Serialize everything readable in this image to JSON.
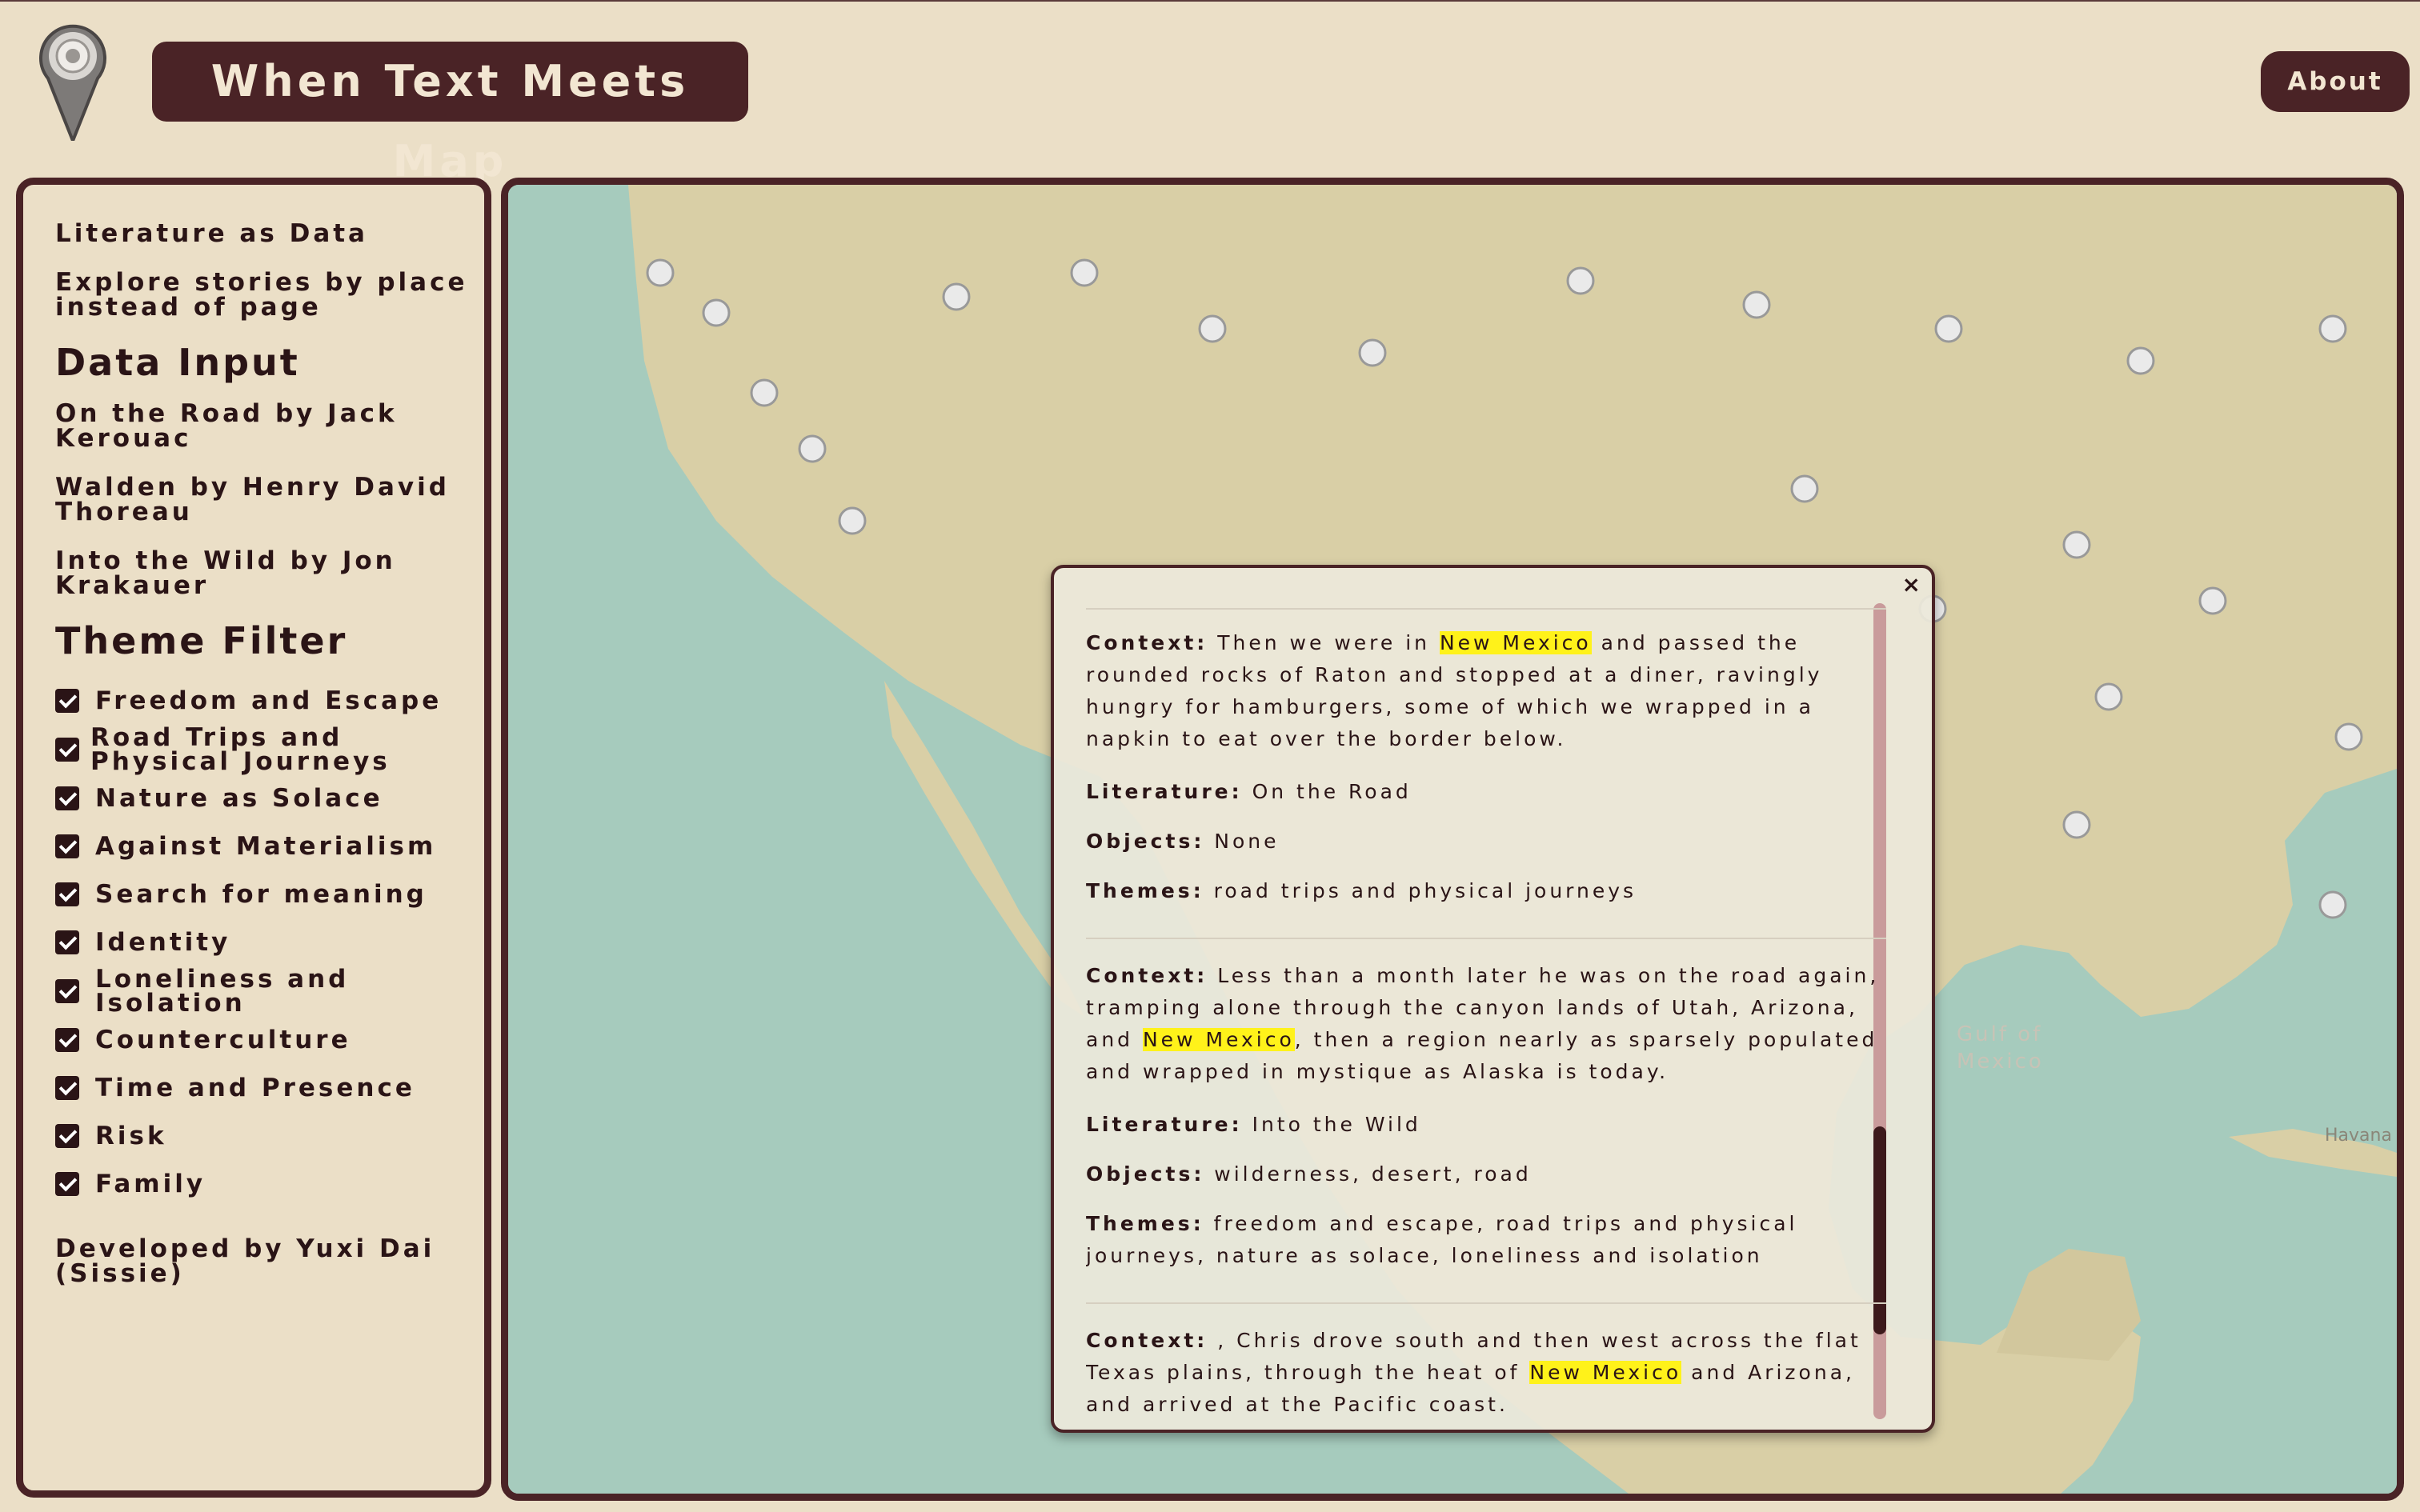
{
  "header": {
    "title": "When Text Meets Map",
    "about_label": "About"
  },
  "sidebar": {
    "intro1": "Literature as Data",
    "intro2a": "Explore stories by place",
    "intro2b": "instead of page",
    "data_input_heading": "Data Input",
    "books": [
      {
        "line1": "On the Road by Jack",
        "line2": "Kerouac"
      },
      {
        "line1": "Walden by Henry David",
        "line2": "Thoreau"
      },
      {
        "line1": "Into the Wild by Jon",
        "line2": "Krakauer"
      }
    ],
    "theme_heading": "Theme Filter",
    "themes": [
      {
        "line1": "Freedom and Escape",
        "checked": true
      },
      {
        "line1": "Road Trips and",
        "line2": "Physical Journeys",
        "checked": true
      },
      {
        "line1": "Nature as Solace",
        "checked": true
      },
      {
        "line1": "Against Materialism",
        "checked": true
      },
      {
        "line1": "Search for meaning",
        "checked": true
      },
      {
        "line1": "Identity",
        "checked": true
      },
      {
        "line1": "Loneliness and",
        "line2": "Isolation",
        "checked": true
      },
      {
        "line1": "Counterculture",
        "checked": true
      },
      {
        "line1": "Time and Presence",
        "checked": true
      },
      {
        "line1": "Risk",
        "checked": true
      },
      {
        "line1": "Family",
        "checked": true
      }
    ],
    "credit1": "Developed by Yuxi Dai",
    "credit2": "(Sissie)"
  },
  "map": {
    "labels": {
      "gulf1": "Gulf of",
      "gulf2": "Mexico",
      "havana": "Havana"
    }
  },
  "popup": {
    "close_label": "×",
    "highlight": "New Mexico",
    "labels": {
      "context": "Context:",
      "literature": "Literature:",
      "objects": "Objects:",
      "themes": "Themes:"
    },
    "entries": [
      {
        "ctx_before": " Then we were in ",
        "ctx_after": " and passed the rounded rocks of Raton and stopped at a diner, ravingly hungry for hamburgers, some of which we wrapped in a napkin to eat over the border below.",
        "literature": " On the Road",
        "objects": " None",
        "themes": " road trips and physical journeys"
      },
      {
        "ctx_before": " Less than a month later he was on the road again, tramping alone through the canyon lands of Utah, Arizona, and ",
        "ctx_after": ", then a region nearly as sparsely populated and wrapped in mystique as Alaska is today.",
        "literature": " Into the Wild",
        "objects": " wilderness, desert, road",
        "themes": " freedom and escape, road trips and physical journeys, nature as solace, loneliness and isolation"
      },
      {
        "ctx_before": " , Chris drove south and then west across the flat Texas plains, through the heat of ",
        "ctx_after": " and Arizona, and arrived at the Pacific coast."
      }
    ]
  },
  "colors": {
    "background": "#ebdfc7",
    "brand": "#4a2326",
    "highlight": "#fff21a",
    "water": "#a6cbbd",
    "land": "#d9cfa6"
  }
}
